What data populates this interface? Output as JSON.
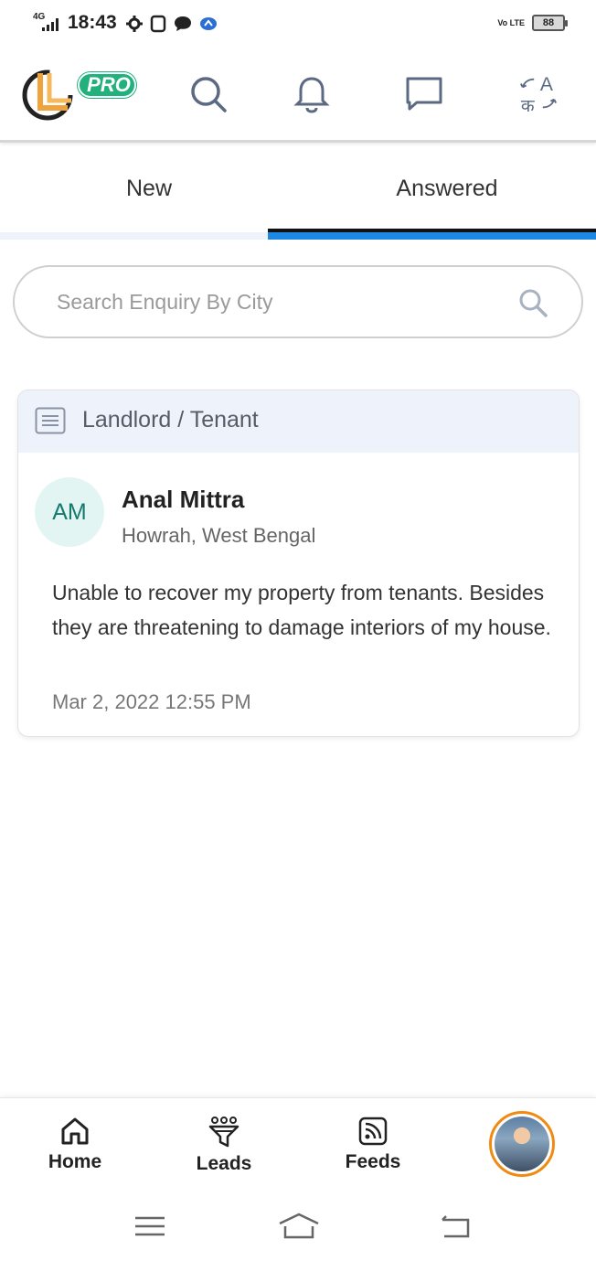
{
  "status_bar": {
    "network": "4G",
    "time": "18:43",
    "volte": "Vo LTE",
    "battery": "88"
  },
  "header": {
    "logo_badge": "PRO",
    "icons": [
      "search-icon",
      "bell-icon",
      "chat-icon",
      "translate-icon"
    ]
  },
  "tabs": [
    {
      "label": "New",
      "active": false
    },
    {
      "label": "Answered",
      "active": true
    }
  ],
  "search": {
    "placeholder": "Search Enquiry By City",
    "value": ""
  },
  "enquiry": {
    "category": "Landlord / Tenant",
    "initials": "AM",
    "name": "Anal Mittra",
    "location": "Howrah, West Bengal",
    "message": "Unable to recover my property from tenants. Besides they are threatening to damage interiors of my house.",
    "date": "Mar 2, 2022 12:55 PM"
  },
  "bottom_nav": {
    "items": [
      {
        "label": "Home",
        "icon": "home-icon"
      },
      {
        "label": "Leads",
        "icon": "funnel-icon"
      },
      {
        "label": "Feeds",
        "icon": "rss-icon"
      }
    ],
    "profile": "profile-avatar"
  },
  "colors": {
    "accent": "#1e88e5",
    "pro_badge": "#22b07d",
    "logo_orange": "#f0a23b",
    "avatar_bg": "#e3f5f2",
    "avatar_text": "#157a6e",
    "profile_ring": "#ef8a12"
  }
}
